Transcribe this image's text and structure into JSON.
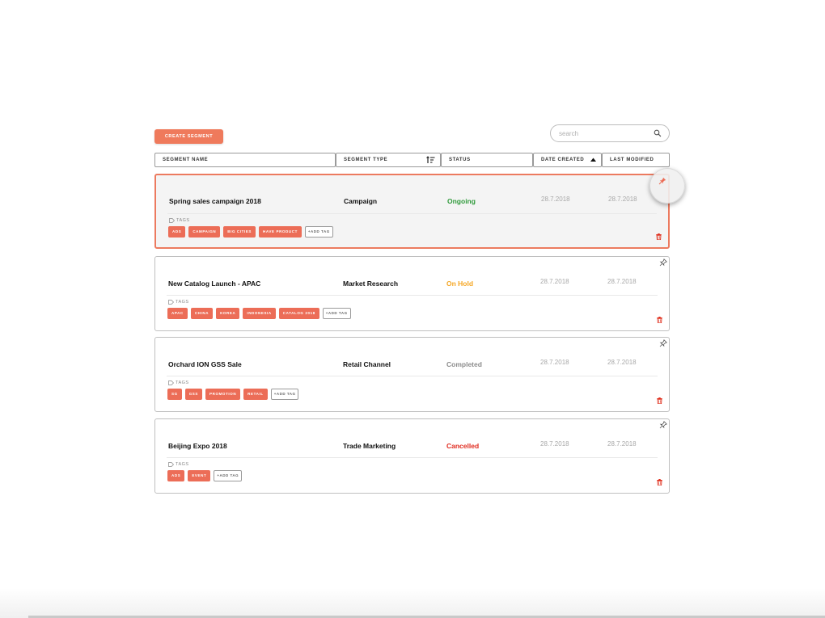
{
  "toolbar": {
    "create_label": "CREATE SEGMENT",
    "search_placeholder": "search"
  },
  "columns": {
    "segment_name": "SEGMENT NAME",
    "segment_type": "SEGMENT TYPE",
    "status": "STATUS",
    "date_created": "DATE CREATED",
    "last_modified": "LAST MODIFIED"
  },
  "labels": {
    "tags": "TAGS",
    "add_tag": "+ADD TAG"
  },
  "colors": {
    "accent": "#ec6d57",
    "ongoing": "#2f9a3b",
    "on_hold": "#f5a623",
    "completed": "#8c8c8c",
    "cancelled": "#e02b1f"
  },
  "segments": [
    {
      "name": "Spring sales campaign 2018",
      "type": "Campaign",
      "status": "Ongoing",
      "date_created": "28.7.2018",
      "last_modified": "28.7.2018",
      "tags": [
        "ADS",
        "CAMPAIGN",
        "BIG CITIES",
        "HAVE PRODUCT"
      ],
      "selected": true,
      "pinned": true
    },
    {
      "name": "New Catalog Launch - APAC",
      "type": "Market Research",
      "status": "On Hold",
      "date_created": "28.7.2018",
      "last_modified": "28.7.2018",
      "tags": [
        "APAC",
        "CHINA",
        "KOREA",
        "INDONESIA",
        "CATALOG 2018"
      ]
    },
    {
      "name": "Orchard ION GSS Sale",
      "type": "Retail Channel",
      "status": "Completed",
      "date_created": "28.7.2018",
      "last_modified": "28.7.2018",
      "tags": [
        "SG",
        "GSS",
        "PROMOTION",
        "RETAIL"
      ]
    },
    {
      "name": "Beijing Expo 2018",
      "type": "Trade Marketing",
      "status": "Cancelled",
      "date_created": "28.7.2018",
      "last_modified": "28.7.2018",
      "tags": [
        "ADS",
        "EVENT"
      ]
    }
  ]
}
